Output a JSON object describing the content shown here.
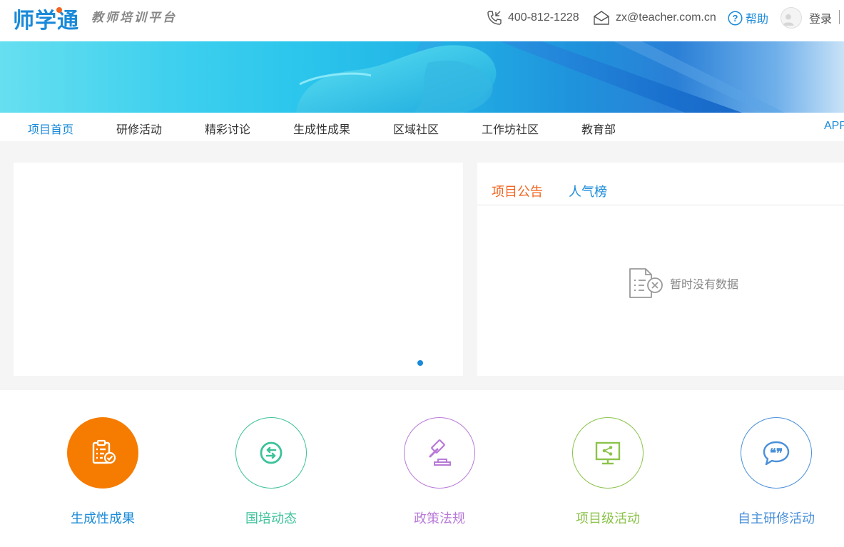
{
  "header": {
    "logo": "师学通",
    "slogan": "教师培训平台",
    "phone": "400-812-1228",
    "email": "zx@teacher.com.cn",
    "help": "帮助",
    "login": "登录"
  },
  "nav": {
    "items": [
      {
        "label": "项目首页",
        "active": true
      },
      {
        "label": "研修活动"
      },
      {
        "label": "精彩讨论"
      },
      {
        "label": "生成性成果"
      },
      {
        "label": "区域社区"
      },
      {
        "label": "工作坊社区"
      },
      {
        "label": "教育部"
      }
    ],
    "app": "APP"
  },
  "notice": {
    "tabs": [
      {
        "label": "项目公告",
        "active": true
      },
      {
        "label": "人气榜"
      }
    ],
    "empty_text": "暂时没有数据"
  },
  "quick_links": [
    {
      "label": "生成性成果",
      "icon": "clipboard-check-icon",
      "color": "#f57c00",
      "filled": true
    },
    {
      "label": "国培动态",
      "icon": "exchange-icon",
      "color": "#3cc29a"
    },
    {
      "label": "政策法规",
      "icon": "gavel-icon",
      "color": "#b97ad8"
    },
    {
      "label": "项目级活动",
      "icon": "monitor-share-icon",
      "color": "#8bc34a"
    },
    {
      "label": "自主研修活动",
      "icon": "chat-quote-icon",
      "color": "#4a90d9"
    }
  ],
  "colors": {
    "brand": "#1a8ad9",
    "accent": "#f26522"
  }
}
